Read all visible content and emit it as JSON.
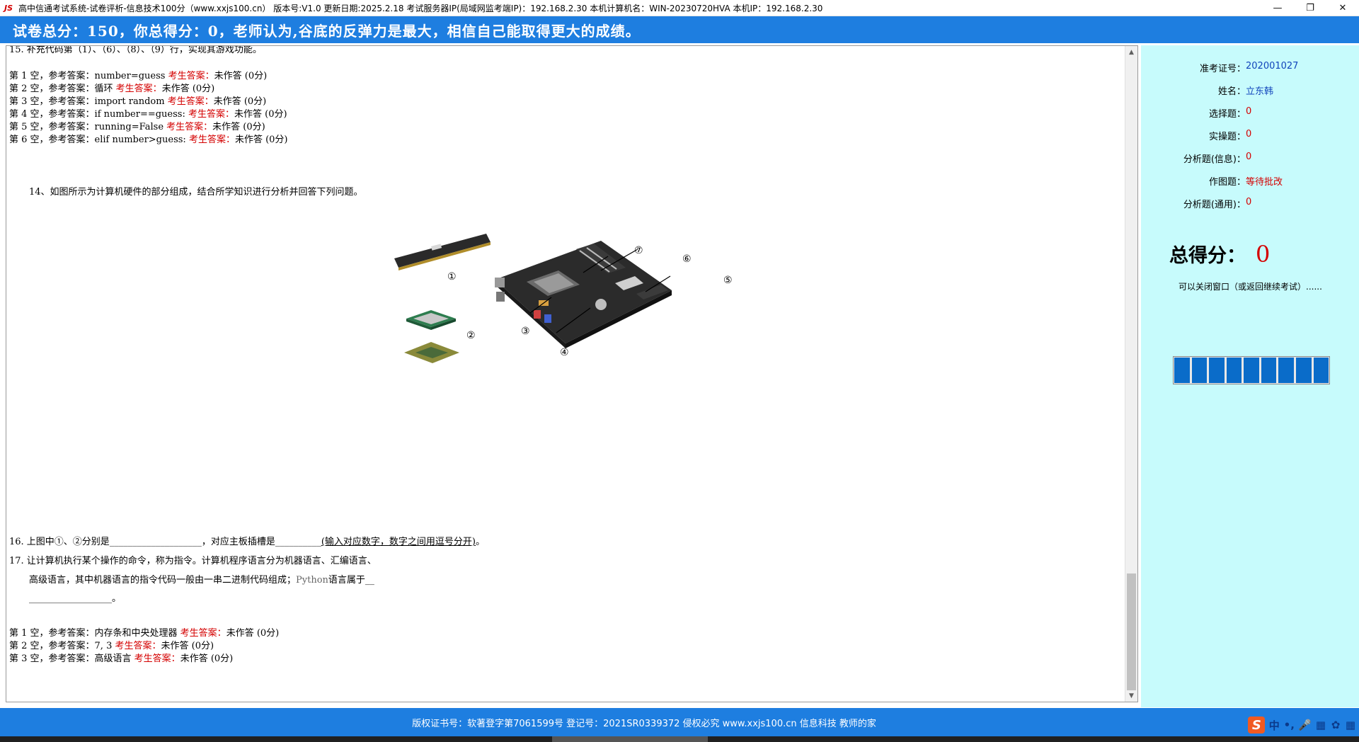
{
  "window": {
    "title": "高中信通考试系统-试卷评析-信息技术100分（www.xxjs100.cn） 版本号:V1.0 更新日期:2025.2.18 考试服务器IP(局域网监考端IP)：192.168.2.30 本机计算机名：WIN-20230720HVA 本机IP：192.168.2.30",
    "icon_label": "JS",
    "minimize": "—",
    "maximize": "❐",
    "close": "✕"
  },
  "banner": {
    "text": "试卷总分：150，你总得分：0，老师认为,谷底的反弹力是最大，相信自己能取得更大的成绩。"
  },
  "q15": {
    "text": "15. 补充代码第（1）、（6）、（8）、（9）行，实现其游戏功能。",
    "answers": [
      {
        "label": "第 1 空，参考答案：number=guess ",
        "student_label": "考生答案：",
        "result": "未作答 (0分)"
      },
      {
        "label": "第 2 空，参考答案：循环 ",
        "student_label": "考生答案：",
        "result": "未作答 (0分)"
      },
      {
        "label": "第 3 空，参考答案：import random ",
        "student_label": "考生答案：",
        "result": "未作答 (0分)"
      },
      {
        "label": "第 4 空，参考答案：if number==guess: ",
        "student_label": "考生答案：",
        "result": "未作答 (0分)"
      },
      {
        "label": "第 5 空，参考答案：running=False ",
        "student_label": "考生答案：",
        "result": "未作答 (0分)"
      },
      {
        "label": "第 6 空，参考答案：elif number>guess: ",
        "student_label": "考生答案：",
        "result": "未作答 (0分)"
      }
    ]
  },
  "q14": {
    "text": "14、如图所示为计算机硬件的部分组成，结合所学知识进行分析并回答下列问题。",
    "figure_labels": [
      "①",
      "②",
      "③",
      "④",
      "⑤",
      "⑥",
      "⑦"
    ]
  },
  "q16": {
    "prefix": "16. 上图中①、②分别是",
    "blank1": "____________________",
    "middle": "，对应主板插槽是",
    "blank2": "__________",
    "hint": "(输入对应数字，数字之间用逗号分开)",
    "suffix": "。"
  },
  "q17": {
    "line1": "17. 让计算机执行某个操作的命令，称为指令。计算机程序语言分为机器语言、汇编语言、",
    "line2_prefix": "高级语言，其中机器语言的指令代码一般由一串二进制代码组成；",
    "line2_python": "Python",
    "line2_suffix": "语言属于__",
    "line3": "__________________。"
  },
  "answers_2": [
    {
      "label": "第 1 空，参考答案：内存条和中央处理器 ",
      "student_label": "考生答案：",
      "result": "未作答 (0分)"
    },
    {
      "label": "第 2 空，参考答案：7, 3 ",
      "student_label": "考生答案：",
      "result": "未作答 (0分)"
    },
    {
      "label": "第 3 空，参考答案：高级语言 ",
      "student_label": "考生答案：",
      "result": "未作答 (0分)"
    }
  ],
  "scrollbar": {
    "up": "▲",
    "down": "▼"
  },
  "side": {
    "exam_id_label": "准考证号：",
    "exam_id": "202001027",
    "name_label": "姓名：",
    "name": "立东韩",
    "choice_label": "选择题：",
    "choice": "0",
    "practical_label": "实操题：",
    "practical": "0",
    "analysis_info_label": "分析题(信息)：",
    "analysis_info": "0",
    "drawing_label": "作图题：",
    "drawing": "等待批改",
    "analysis_general_label": "分析题(通用)：",
    "analysis_general": "0",
    "total_label": "总得分：",
    "total": "0",
    "close_note": "可以关闭窗口（或返回继续考试）......",
    "progress_segments": 9
  },
  "footer": {
    "text": "版权证书号：软著登字第7061599号 登记号：2021SR0339372  侵权必究  www.xxjs100.cn  信息科技 教师的家"
  },
  "ime": {
    "logo": "S",
    "items": [
      "中",
      "•,",
      "🎤",
      "▦",
      "✿",
      "▦"
    ]
  },
  "colors": {
    "banner": "#1e7ee0",
    "side": "#c7fbfc",
    "red": "#d40000",
    "blue_text": "#1144bb",
    "progress": "#0a6cc9"
  }
}
